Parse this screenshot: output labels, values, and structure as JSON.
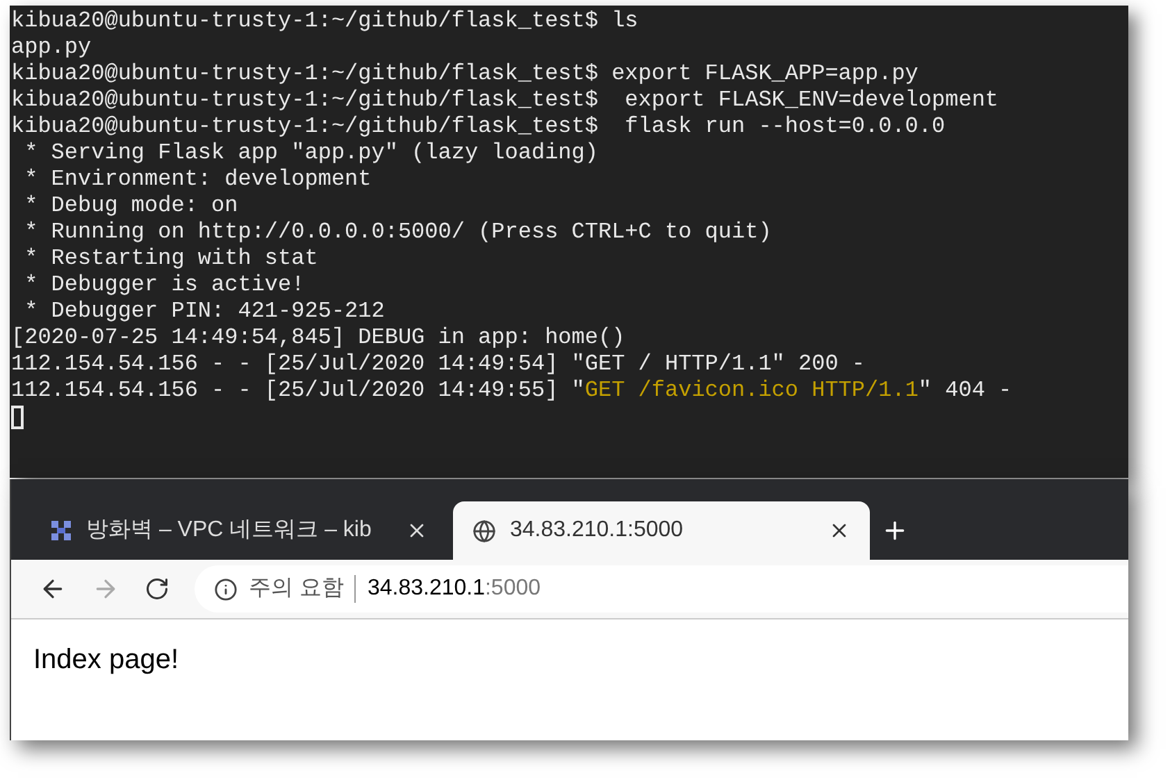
{
  "terminal": {
    "lines": [
      {
        "segments": [
          {
            "text": "kibua20@ubuntu-trusty-1:~/github/flask_test$ ls",
            "kind": "plain"
          }
        ]
      },
      {
        "segments": [
          {
            "text": "app.py",
            "kind": "plain"
          }
        ]
      },
      {
        "segments": [
          {
            "text": "kibua20@ubuntu-trusty-1:~/github/flask_test$ export FLASK_APP=app.py",
            "kind": "plain"
          }
        ]
      },
      {
        "segments": [
          {
            "text": "kibua20@ubuntu-trusty-1:~/github/flask_test$  export FLASK_ENV=development",
            "kind": "plain"
          }
        ]
      },
      {
        "segments": [
          {
            "text": "kibua20@ubuntu-trusty-1:~/github/flask_test$  flask run --host=0.0.0.0",
            "kind": "plain"
          }
        ]
      },
      {
        "segments": [
          {
            "text": " * Serving Flask app \"app.py\" (lazy loading)",
            "kind": "plain"
          }
        ]
      },
      {
        "segments": [
          {
            "text": " * Environment: development",
            "kind": "plain"
          }
        ]
      },
      {
        "segments": [
          {
            "text": " * Debug mode: on",
            "kind": "plain"
          }
        ]
      },
      {
        "segments": [
          {
            "text": " * Running on http://0.0.0.0:5000/ (Press CTRL+C to quit)",
            "kind": "plain"
          }
        ]
      },
      {
        "segments": [
          {
            "text": " * Restarting with stat",
            "kind": "plain"
          }
        ]
      },
      {
        "segments": [
          {
            "text": " * Debugger is active!",
            "kind": "plain"
          }
        ]
      },
      {
        "segments": [
          {
            "text": " * Debugger PIN: 421-925-212",
            "kind": "plain"
          }
        ]
      },
      {
        "segments": [
          {
            "text": "[2020-07-25 14:49:54,845] DEBUG in app: home()",
            "kind": "plain"
          }
        ]
      },
      {
        "segments": [
          {
            "text": "112.154.54.156 - - [25/Jul/2020 14:49:54] \"GET / HTTP/1.1\" 200 -",
            "kind": "plain"
          }
        ]
      },
      {
        "segments": [
          {
            "text": "112.154.54.156 - - [25/Jul/2020 14:49:55] \"",
            "kind": "plain"
          },
          {
            "text": "GET /favicon.ico HTTP/1.1",
            "kind": "highlight"
          },
          {
            "text": "\" 404 -",
            "kind": "plain"
          }
        ]
      }
    ]
  },
  "browser": {
    "tabs": [
      {
        "title": "방화벽 – VPC 네트워크 – kib",
        "selected": false
      },
      {
        "title": "34.83.210.1:5000",
        "selected": true
      }
    ],
    "address": {
      "security_label": "주의 요함",
      "host": "34.83.210.1",
      "port": ":5000"
    },
    "page": {
      "text": "Index page!"
    }
  }
}
